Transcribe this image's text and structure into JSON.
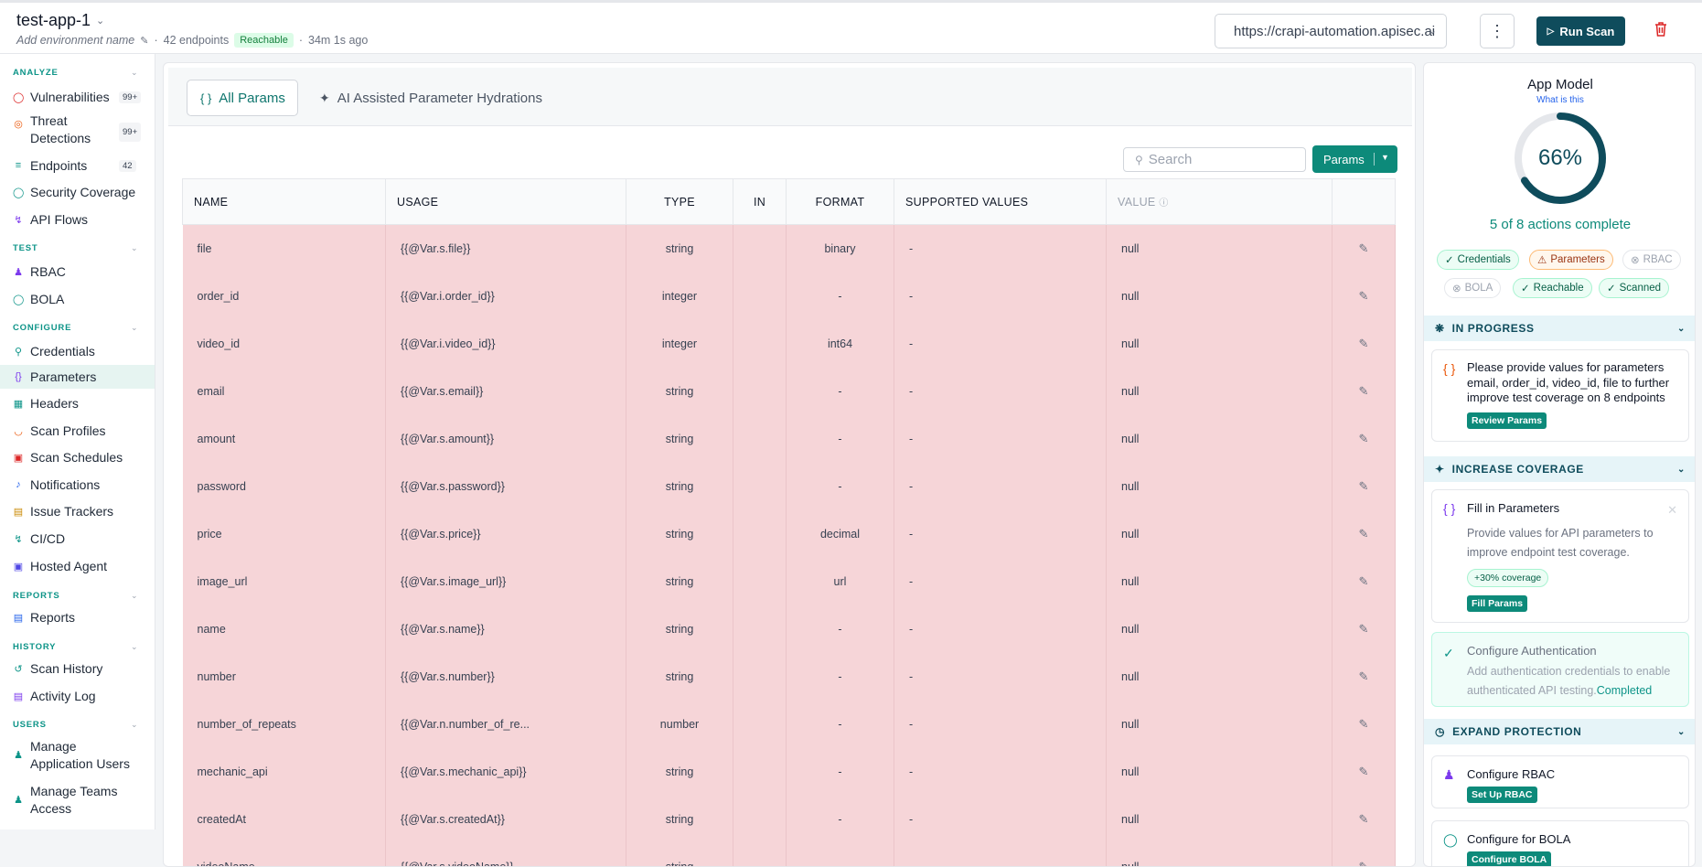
{
  "header": {
    "app_name": "test-app-1",
    "env_placeholder": "Add environment name",
    "endpoints": "42 endpoints",
    "status": "Reachable",
    "last_scan": "34m 1s ago",
    "url": "https://crapi-automation.apisec.ai",
    "run_scan": "Run Scan"
  },
  "sidebar": {
    "analyze": "ANALYZE",
    "test": "TEST",
    "configure": "CONFIGURE",
    "reports": "REPORTS",
    "history": "HISTORY",
    "users": "USERS",
    "items": {
      "vulnerabilities": "Vulnerabilities",
      "vulnerabilities_count": "99+",
      "threat1": "Threat",
      "threat2": "Detections",
      "threat_count": "99+",
      "endpoints": "Endpoints",
      "endpoints_count": "42",
      "security_coverage": "Security Coverage",
      "api_flows": "API Flows",
      "rbac": "RBAC",
      "bola": "BOLA",
      "credentials": "Credentials",
      "parameters": "Parameters",
      "headers": "Headers",
      "scan_profiles": "Scan Profiles",
      "scan_schedules": "Scan Schedules",
      "notifications": "Notifications",
      "issue_trackers": "Issue Trackers",
      "cicd": "CI/CD",
      "hosted_agent": "Hosted Agent",
      "reports": "Reports",
      "scan_history": "Scan History",
      "activity_log": "Activity Log",
      "manage_app_users1": "Manage",
      "manage_app_users2": "Application Users",
      "manage_teams1": "Manage Teams",
      "manage_teams2": "Access"
    }
  },
  "tabs": {
    "all_params": "All Params",
    "ai_assisted": "AI Assisted Parameter Hydrations"
  },
  "toolbar": {
    "search_placeholder": "Search",
    "params_button": "Params"
  },
  "table": {
    "columns": [
      "NAME",
      "USAGE",
      "TYPE",
      "IN",
      "FORMAT",
      "SUPPORTED VALUES",
      "VALUE"
    ],
    "rows": [
      {
        "name": "file",
        "usage": "{{@Var.s.file}}",
        "type": "string",
        "in": "",
        "format": "binary",
        "supported": "-",
        "value": "null"
      },
      {
        "name": "order_id",
        "usage": "{{@Var.i.order_id}}",
        "type": "integer",
        "in": "",
        "format": "-",
        "supported": "-",
        "value": "null"
      },
      {
        "name": "video_id",
        "usage": "{{@Var.i.video_id}}",
        "type": "integer",
        "in": "",
        "format": "int64",
        "supported": "-",
        "value": "null"
      },
      {
        "name": "email",
        "usage": "{{@Var.s.email}}",
        "type": "string",
        "in": "",
        "format": "-",
        "supported": "-",
        "value": "null"
      },
      {
        "name": "amount",
        "usage": "{{@Var.s.amount}}",
        "type": "string",
        "in": "",
        "format": "-",
        "supported": "-",
        "value": "null"
      },
      {
        "name": "password",
        "usage": "{{@Var.s.password}}",
        "type": "string",
        "in": "",
        "format": "-",
        "supported": "-",
        "value": "null"
      },
      {
        "name": "price",
        "usage": "{{@Var.s.price}}",
        "type": "string",
        "in": "",
        "format": "decimal",
        "supported": "-",
        "value": "null"
      },
      {
        "name": "image_url",
        "usage": "{{@Var.s.image_url}}",
        "type": "string",
        "in": "",
        "format": "url",
        "supported": "-",
        "value": "null"
      },
      {
        "name": "name",
        "usage": "{{@Var.s.name}}",
        "type": "string",
        "in": "",
        "format": "-",
        "supported": "-",
        "value": "null"
      },
      {
        "name": "number",
        "usage": "{{@Var.s.number}}",
        "type": "string",
        "in": "",
        "format": "-",
        "supported": "-",
        "value": "null"
      },
      {
        "name": "number_of_repeats",
        "usage": "{{@Var.n.number_of_re...",
        "type": "number",
        "in": "",
        "format": "-",
        "supported": "-",
        "value": "null"
      },
      {
        "name": "mechanic_api",
        "usage": "{{@Var.s.mechanic_api}}",
        "type": "string",
        "in": "",
        "format": "-",
        "supported": "-",
        "value": "null"
      },
      {
        "name": "createdAt",
        "usage": "{{@Var.s.createdAt}}",
        "type": "string",
        "in": "",
        "format": "-",
        "supported": "-",
        "value": "null"
      },
      {
        "name": "videoName",
        "usage": "{{@Var.s.videoName}}",
        "type": "string",
        "in": "",
        "format": "-",
        "supported": "-",
        "value": "null"
      }
    ]
  },
  "app_model": {
    "title": "App Model",
    "link": "What is this",
    "percent": "66%",
    "progress": 0.66,
    "actions": "5 of 8 actions complete",
    "chips": {
      "credentials": "Credentials",
      "parameters": "Parameters",
      "rbac": "RBAC",
      "bola": "BOLA",
      "reachable": "Reachable",
      "scanned": "Scanned"
    },
    "in_progress": "IN PROGRESS",
    "in_progress_text": "Please provide values for parameters email, order_id, video_id, file to further improve test coverage on 8 endpoints",
    "review_params": "Review Params",
    "increase_coverage": "INCREASE COVERAGE",
    "fill_title": "Fill in Parameters",
    "fill_desc": "Provide values for API parameters to improve endpoint test coverage.",
    "coverage": "+30% coverage",
    "fill_button": "Fill Params",
    "auth_title": "Configure Authentication",
    "auth_desc": "Add authentication credentials to enable authenticated API testing.",
    "auth_status": "Completed",
    "expand_protection": "EXPAND PROTECTION",
    "rbac_title": "Configure RBAC",
    "rbac_button": "Set Up RBAC",
    "bola_title": "Configure for BOLA",
    "bola_button": "Configure BOLA"
  }
}
